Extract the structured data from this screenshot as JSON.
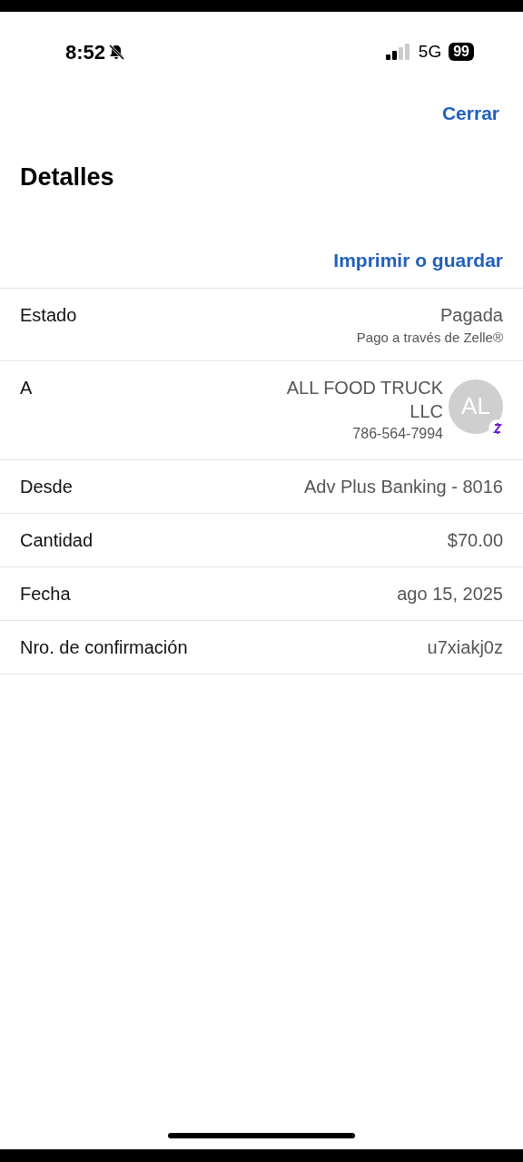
{
  "status_bar": {
    "time": "8:52",
    "network": "5G",
    "battery": "99"
  },
  "nav": {
    "close": "Cerrar",
    "title": "Detalles",
    "print": "Imprimir o guardar"
  },
  "rows": [
    {
      "kind": "text",
      "label": "Estado",
      "value": "Pagada",
      "note": "Pago a través de Zelle®"
    },
    {
      "kind": "contact",
      "label": "A",
      "value": "ALL FOOD TRUCK LLC",
      "note": "786-564-7994",
      "initials": "AL"
    },
    {
      "kind": "text",
      "label": "Desde",
      "value": "Adv Plus Banking - 8016"
    },
    {
      "kind": "text",
      "label": "Cantidad",
      "value": "$70.00"
    },
    {
      "kind": "text",
      "label": "Fecha",
      "value": "ago 15, 2025"
    },
    {
      "kind": "text",
      "label": "Nro. de confirmación",
      "value": "u7xiakj0z"
    }
  ]
}
